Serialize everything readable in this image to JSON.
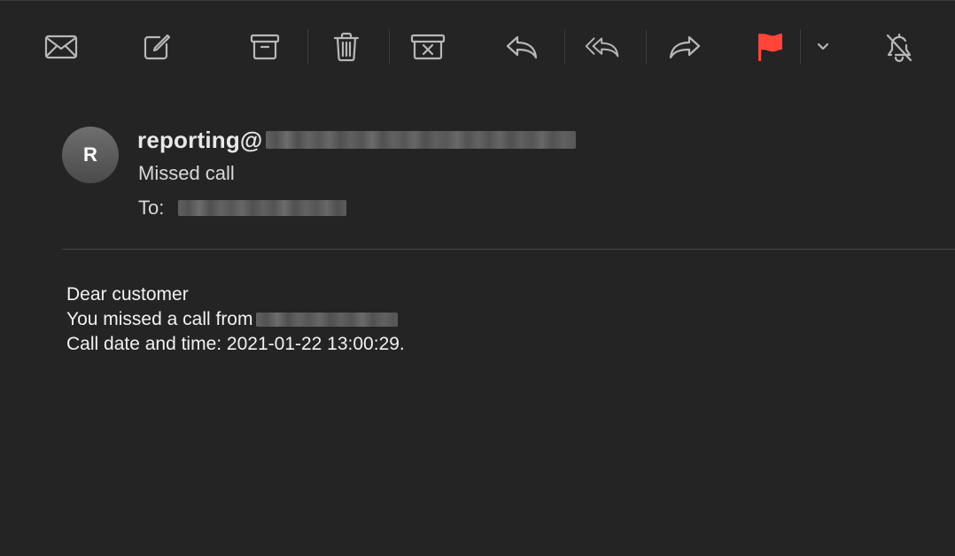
{
  "toolbar": {
    "buttons": [
      {
        "name": "envelope-icon",
        "label": "Get Mail"
      },
      {
        "name": "compose-icon",
        "label": "New Message"
      },
      {
        "name": "archive-icon",
        "label": "Archive"
      },
      {
        "name": "trash-icon",
        "label": "Delete"
      },
      {
        "name": "junk-icon",
        "label": "Junk"
      },
      {
        "name": "reply-icon",
        "label": "Reply"
      },
      {
        "name": "reply-all-icon",
        "label": "Reply All"
      },
      {
        "name": "forward-icon",
        "label": "Forward"
      },
      {
        "name": "flag-icon",
        "label": "Flag"
      },
      {
        "name": "chevron-down-icon",
        "label": "Flag options"
      },
      {
        "name": "bell-slash-icon",
        "label": "Mute"
      }
    ],
    "flag_color": "#ff453a",
    "icon_color": "#b8b8b8"
  },
  "message": {
    "avatar_initial": "R",
    "sender_prefix": "reporting@",
    "subject": "Missed call",
    "to_label": "To:",
    "body": {
      "line1": "Dear customer",
      "line2": "You missed a call from",
      "line3": "Call date and time: 2021-01-22 13:00:29."
    }
  }
}
